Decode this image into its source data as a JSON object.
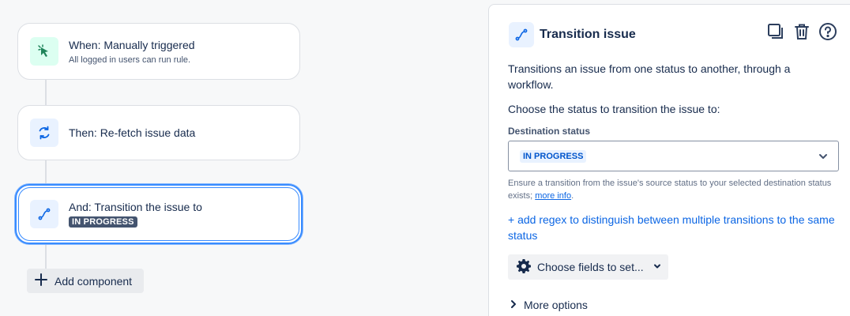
{
  "canvas": {
    "trigger": {
      "title": "When: Manually triggered",
      "subtitle": "All logged in users can run rule.",
      "icon": "cursor-click-icon"
    },
    "action1": {
      "title": "Then: Re-fetch issue data",
      "icon": "refresh-icon"
    },
    "action2": {
      "title": "And: Transition the issue to",
      "status": "IN PROGRESS",
      "icon": "transition-icon"
    },
    "add_component_label": "Add component"
  },
  "panel": {
    "title": "Transition issue",
    "description": "Transitions an issue from one status to another, through a workflow.",
    "choose_text": "Choose the status to transition the issue to:",
    "field_label": "Destination status",
    "selected_status": "IN PROGRESS",
    "help_text": "Ensure a transition from the issue's source status to your selected destination status exists; ",
    "help_link": "more info",
    "help_end": ".",
    "regex_link": "+ add regex to distinguish between multiple transitions to the same status",
    "fields_button": "Choose fields to set...",
    "more_options": "More options"
  },
  "colors": {
    "accent": "#0c66e4",
    "selected_border": "#388bff",
    "dark_lozenge": "#44546f"
  }
}
